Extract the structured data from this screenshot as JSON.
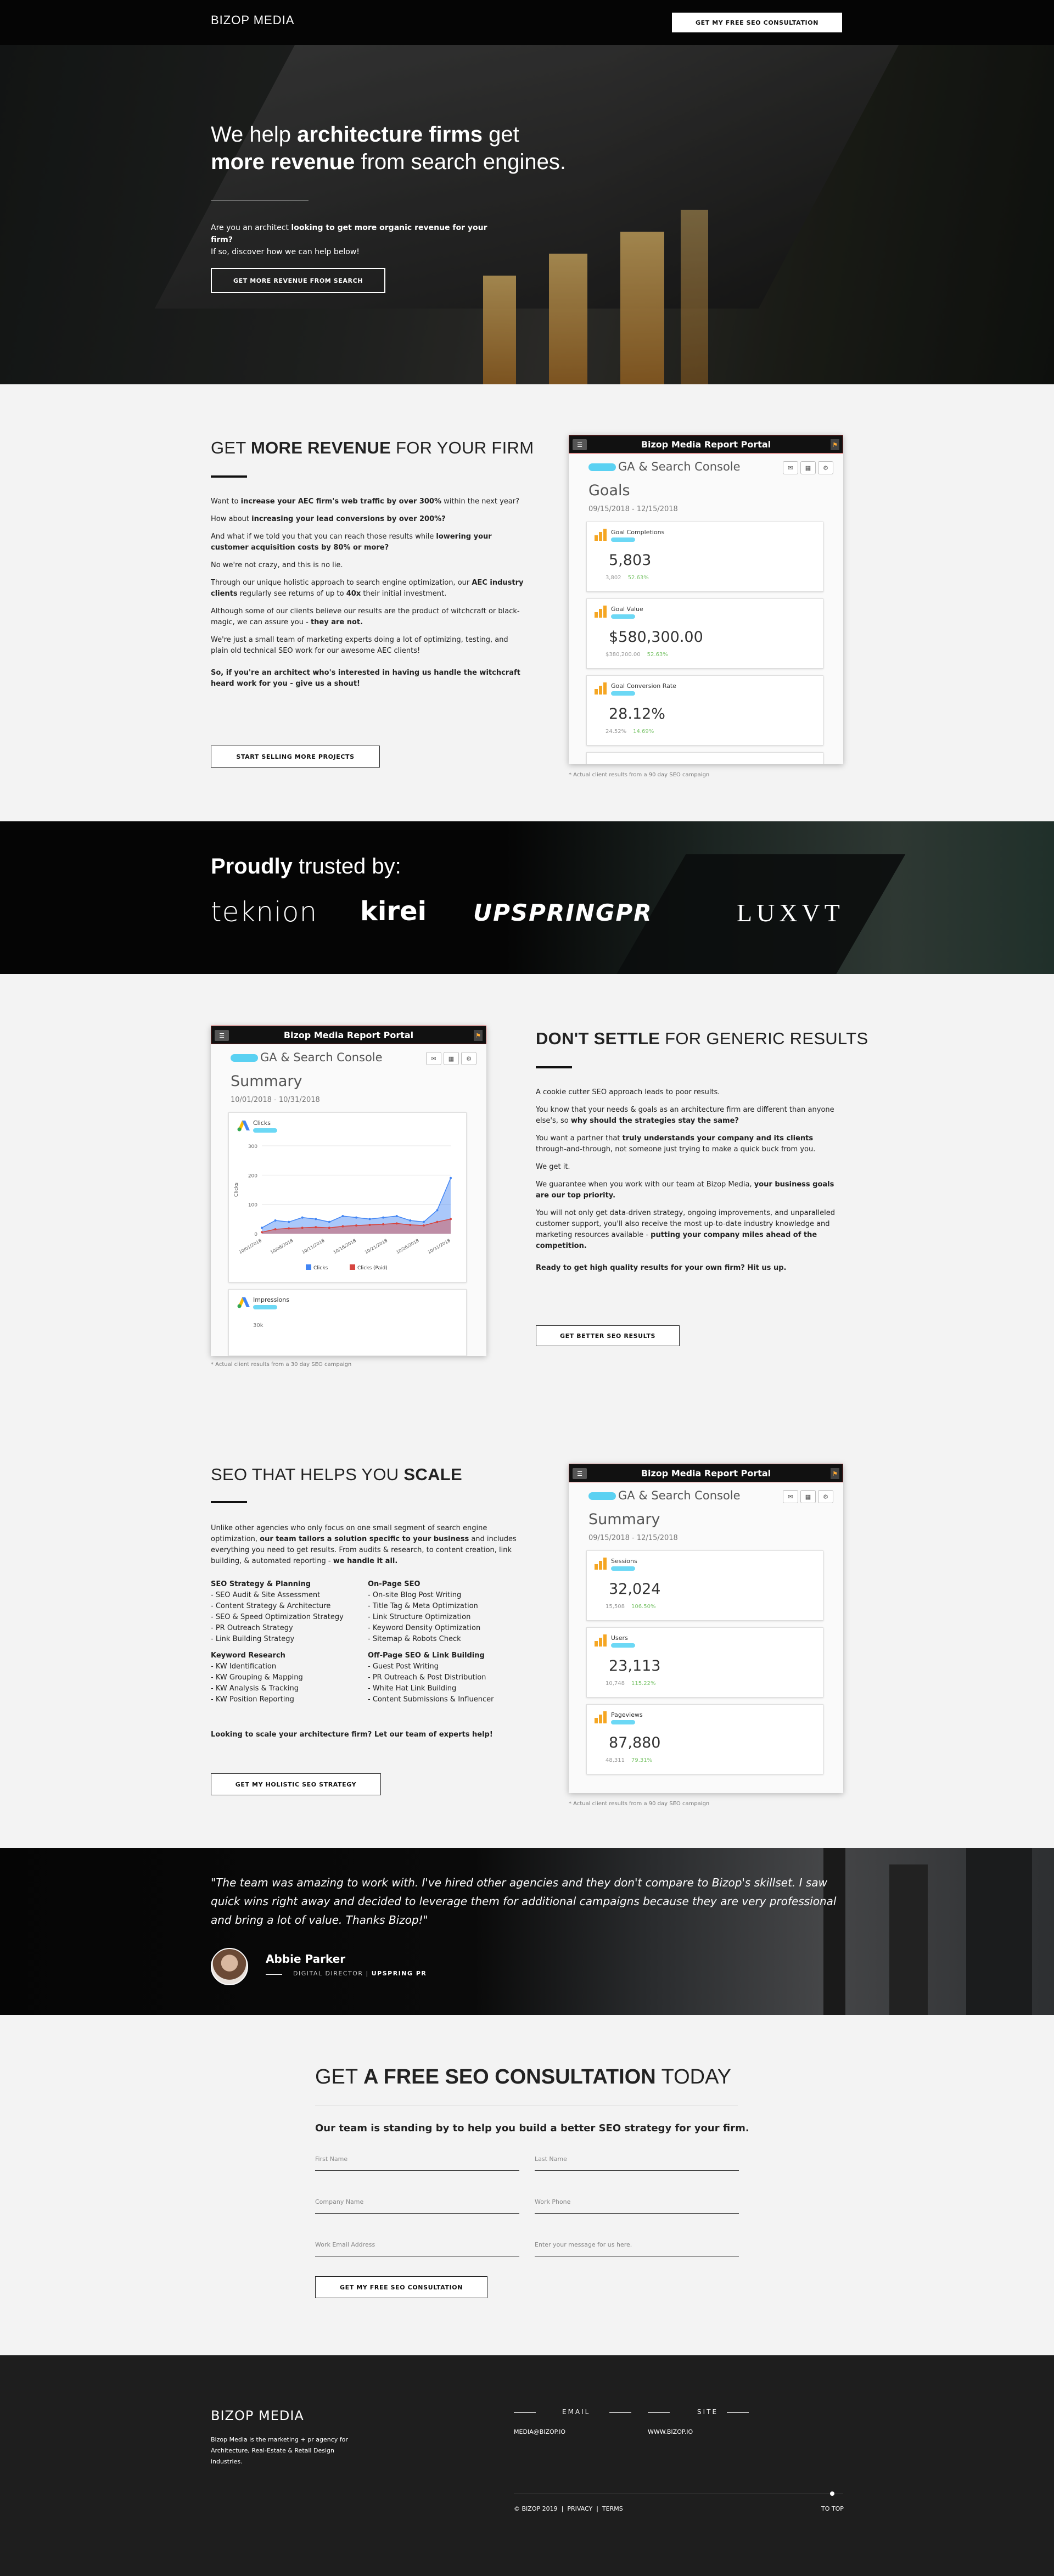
{
  "header": {
    "logo": "BIZOP MEDIA",
    "cta": "GET MY FREE SEO CONSULTATION"
  },
  "hero": {
    "title_1": "We help ",
    "title_2": "architecture firms",
    "title_3": " get",
    "title_4": "more revenue",
    "title_5": " from search engines.",
    "lead_1": "Are you an architect ",
    "lead_2": "looking to get more organic revenue for your firm?",
    "lead_3": "If so, discover how we can help below!",
    "cta": "GET MORE REVENUE FROM SEARCH"
  },
  "revenue": {
    "title_a": "GET ",
    "title_b": "MORE REVENUE",
    "title_c": " FOR YOUR FIRM",
    "p1a": "Want to ",
    "p1b": "increase your AEC firm's web traffic by over 300%",
    "p1c": " within the next year?",
    "p2a": "How about ",
    "p2b": "increasing your lead conversions by over 200%?",
    "p3a": "And what if we told you that you can reach those results while ",
    "p3b": "lowering your customer acquisition costs by 80% or more?",
    "p4": "No we're not crazy, and this is no lie.",
    "p5a": "Through our unique holistic approach to search engine optimization, our ",
    "p5b": "AEC industry clients",
    "p5c": " regularly see returns of up to ",
    "p5d": "40x",
    "p5e": " their initial investment.",
    "p6a": "Although some of our clients believe our results are the product of witchcraft or black-magic, we can assure you - ",
    "p6b": "they are not.",
    "p7": "We're just a small team of marketing experts doing a lot of optimizing, testing, and plain old technical SEO work for our awesome AEC clients!",
    "p8": "So, if you're an architect who's interested in having us handle the witchcraft heard work for you - give us a shout!",
    "cta": "START SELLING MORE PROJECTS"
  },
  "portal1": {
    "header": "Bizop Media Report Portal",
    "source": "GA & Search Console",
    "title": "Goals",
    "date": "09/15/2018 - 12/15/2018",
    "cards": [
      {
        "label": "Goal Completions",
        "value": "5,803",
        "sub1": "3,802",
        "sub2": "52.63%"
      },
      {
        "label": "Goal Value",
        "value": "$580,300.00",
        "sub1": "$380,200.00",
        "sub2": "52.63%"
      },
      {
        "label": "Goal Conversion Rate",
        "value": "28.12%",
        "sub1": "24.52%",
        "sub2": "14.69%"
      }
    ],
    "caption": "* Actual client results from a 90 day SEO campaign"
  },
  "trusted": {
    "title_a": "Proudly",
    "title_b": " trusted by:",
    "brands": [
      "teknion",
      "kirei",
      "UPSPRINGPR",
      "LUXVT"
    ]
  },
  "generic": {
    "title_a": "DON'T SETTLE",
    "title_b": " FOR GENERIC RESULTS",
    "p1": "A cookie cutter SEO approach leads to poor results.",
    "p2a": "You know that your needs & goals as an architecture firm are different than anyone else's, so ",
    "p2b": "why should the strategies stay the same?",
    "p3a": "You want a partner that ",
    "p3b": "truly understands your company and its clients",
    "p3c": " through-and-through, not someone just trying to make a quick buck from you.",
    "p4": "We get it.",
    "p5a": "We guarantee when you work with our team at Bizop Media, ",
    "p5b": "your business goals are our top priority.",
    "p6a": "You will not only get data-driven strategy, ongoing improvements, and unparalleled customer support, you'll also receive the most up-to-date industry knowledge and marketing resources available - ",
    "p6b": "putting your company miles ahead of the competition.",
    "p7": "Ready to get high quality results for your own firm? Hit us up.",
    "cta": "GET BETTER SEO RESULTS"
  },
  "portal2": {
    "header": "Bizop Media Report Portal",
    "source": "GA & Search Console",
    "title": "Summary",
    "date": "10/01/2018 - 10/31/2018",
    "card_label": "Clicks",
    "card2_label": "Impressions",
    "card2_tick": "30k",
    "caption": "* Actual client results from a 30 day SEO campaign"
  },
  "chart_data": {
    "type": "area",
    "series": [
      {
        "name": "Clicks",
        "values": [
          20,
          45,
          40,
          55,
          50,
          40,
          60,
          55,
          50,
          55,
          60,
          45,
          40,
          80,
          190
        ]
      },
      {
        "name": "Clicks (Paid)",
        "values": [
          5,
          15,
          18,
          20,
          22,
          20,
          25,
          28,
          30,
          32,
          35,
          30,
          28,
          40,
          50
        ]
      }
    ],
    "x_ticks": [
      "10/01/2018",
      "10/06/2018",
      "10/11/2018",
      "10/16/2018",
      "10/21/2018",
      "10/26/2018",
      "10/31/2018"
    ],
    "y_ticks": [
      "0",
      "100",
      "200",
      "300"
    ],
    "ylabel": "Clicks",
    "ylim": [
      0,
      300
    ]
  },
  "scale": {
    "title_a": "SEO THAT HELPS YOU ",
    "title_b": "SCALE",
    "intro_a": "Unlike other agencies who only focus on one small segment of search engine optimization, ",
    "intro_b": "our team tailors a solution specific to your business",
    "intro_c": " and includes everything you need to get results. From audits & research, to content creation, link building, & automated reporting - ",
    "intro_d": "we handle it all.",
    "col1_h1": "SEO Strategy & Planning",
    "col1_l1": [
      "- SEO Audit & Site Assessment",
      "- Content Strategy & Architecture",
      "- SEO & Speed Optimization Strategy",
      "- PR Outreach Strategy",
      "- Link Building Strategy"
    ],
    "col1_h2": "Keyword Research",
    "col1_l2": [
      "- KW Identification",
      "- KW Grouping & Mapping",
      "- KW Analysis & Tracking",
      "- KW Position Reporting"
    ],
    "col2_h1": "On-Page SEO",
    "col2_l1": [
      "- On-site Blog Post Writing",
      "- Title Tag & Meta Optimization",
      "- Link Structure Optimization",
      "- Keyword Density Optimization",
      "- Sitemap & Robots Check"
    ],
    "col2_h2": "Off-Page SEO & Link Building",
    "col2_l2": [
      "- Guest Post Writing",
      "- PR Outreach & Post Distribution",
      "- White Hat Link Building",
      "- Content Submissions & Influencer"
    ],
    "closing": "Looking to scale your architecture firm? Let our team of experts help!",
    "cta": "GET MY HOLISTIC SEO STRATEGY"
  },
  "portal3": {
    "header": "Bizop Media Report Portal",
    "source": "GA & Search Console",
    "title": "Summary",
    "date": "09/15/2018 - 12/15/2018",
    "cards": [
      {
        "label": "Sessions",
        "value": "32,024",
        "sub1": "15,508",
        "sub2": "106.50%"
      },
      {
        "label": "Users",
        "value": "23,113",
        "sub1": "10,748",
        "sub2": "115.22%"
      },
      {
        "label": "Pageviews",
        "value": "87,880",
        "sub1": "48,311",
        "sub2": "79.31%"
      }
    ],
    "caption": "* Actual client results from a 90 day SEO campaign"
  },
  "testimonial": {
    "quote": "\"The team was amazing to work with. I've hired other agencies and they don't compare to Bizop's skillset. I saw quick wins right away and decided to leverage them for additional campaigns because they are very professional and bring a lot of value. Thanks Bizop!\"",
    "name": "Abbie Parker",
    "role": "DIGITAL DIRECTOR | ",
    "company": "UPSPRING PR"
  },
  "form": {
    "title_a": "GET ",
    "title_b": "A FREE SEO CONSULTATION",
    "title_c": " TODAY",
    "subtitle": "Our team is standing by to help you build a better SEO strategy for your firm.",
    "first_name": "First Name",
    "last_name": "Last Name",
    "company": "Company Name",
    "phone": "Work Phone",
    "email": "Work Email Address",
    "message": "Enter your message for us here.",
    "submit": "GET MY FREE SEO CONSULTATION"
  },
  "footer": {
    "logo": "BIZOP MEDIA",
    "about": "Bizop Media is the marketing + pr agency for Architecture, Real-Estate & Retail Design industries.",
    "email_head": "EMAIL",
    "email": "MEDIA@BIZOP.IO",
    "site_head": "SITE",
    "site": "WWW.BIZOP.IO",
    "copyright": "© BIZOP 2019",
    "privacy": "PRIVACY",
    "terms": "TERMS",
    "top": "TO TOP"
  }
}
